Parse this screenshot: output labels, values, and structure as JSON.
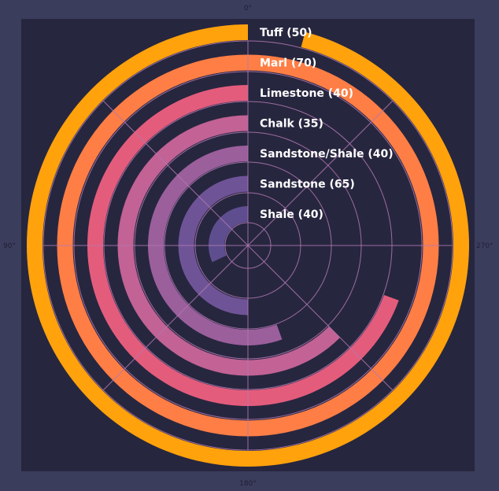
{
  "chart_data": {
    "type": "radial-bar",
    "title": "",
    "angle_ticks": [
      "0°",
      "90°",
      "180°",
      "270°"
    ],
    "direction": "counterclockwise",
    "start": "top",
    "categories": [
      "Shale",
      "Sandstone",
      "Sandstone/Shale",
      "Chalk",
      "Limestone",
      "Marl",
      "Tuff"
    ],
    "values": [
      40,
      65,
      40,
      35,
      40,
      70,
      50
    ],
    "bar_labels": [
      "Shale (40)",
      "Sandstone (65)",
      "Sandstone/Shale (40)",
      "Chalk (35)",
      "Limestone (40)",
      "Marl (70)",
      "Tuff (50)"
    ],
    "sweep_degrees": [
      115,
      180,
      200,
      225,
      250,
      360,
      345
    ],
    "colors": [
      "#5f4e8f",
      "#6e5497",
      "#9b5f9c",
      "#c26295",
      "#e45c7c",
      "#ff7e45",
      "#ffa20c"
    ],
    "grid": true,
    "background": "#27263f",
    "frame": "#3b3d5d"
  }
}
